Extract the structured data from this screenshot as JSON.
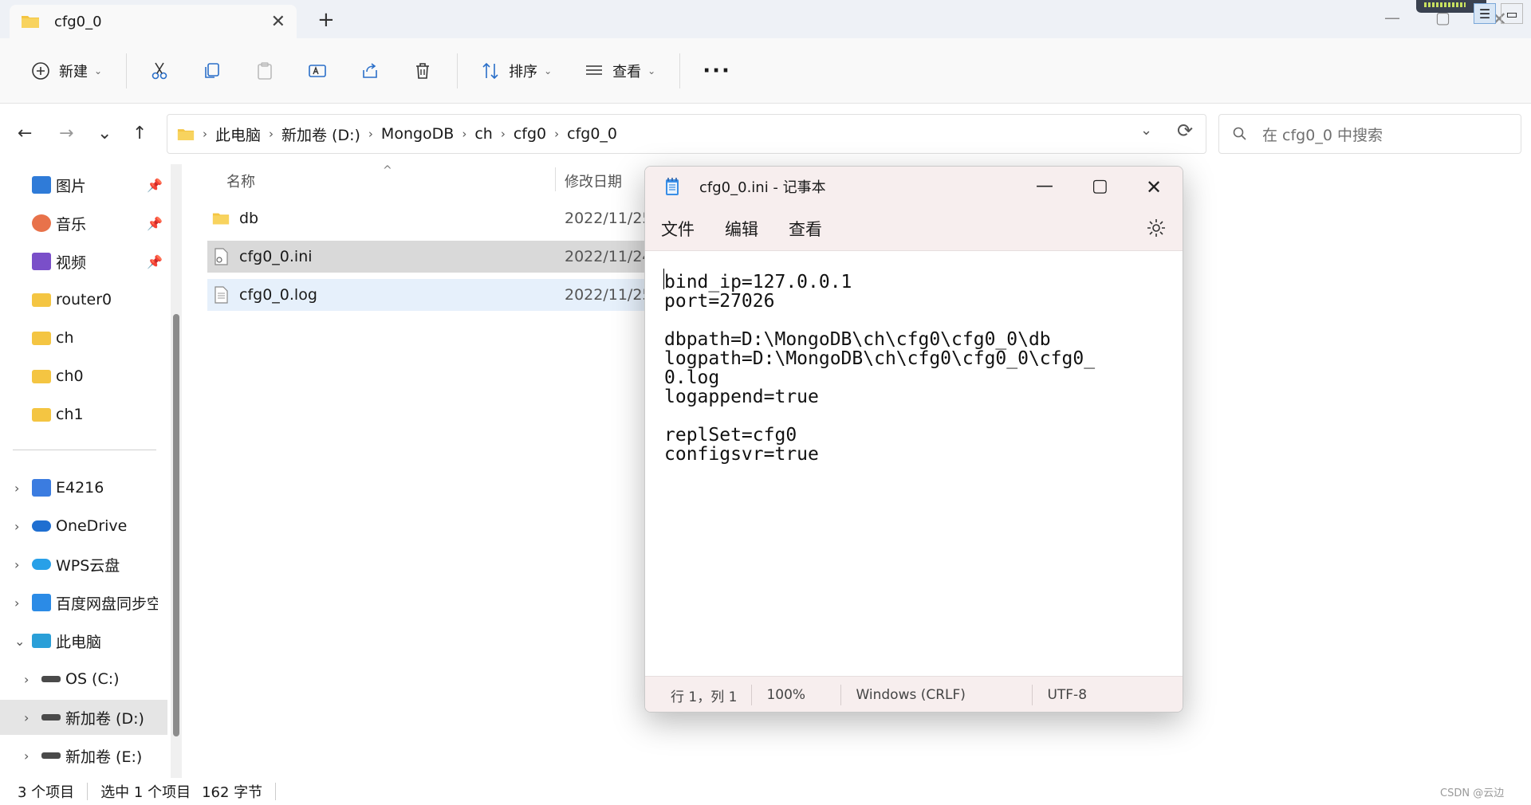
{
  "tab": {
    "title": "cfg0_0",
    "close": "✕",
    "new_tab": "+"
  },
  "window_controls": {
    "minimize": "—",
    "maximize": "▢",
    "close": "✕"
  },
  "toolbar": {
    "new_label": "新建",
    "sort_label": "排序",
    "view_label": "查看",
    "more_label": "···"
  },
  "nav": {
    "back": "←",
    "forward": "→",
    "recent": "⌄",
    "up": "↑"
  },
  "breadcrumb": [
    "此电脑",
    "新加卷 (D:)",
    "MongoDB",
    "ch",
    "cfg0",
    "cfg0_0"
  ],
  "address": {
    "dropdown": "⌄",
    "refresh": "⟳"
  },
  "search": {
    "placeholder": "在 cfg0_0 中搜索"
  },
  "sidebar": {
    "quick_access": [
      {
        "label": "图片",
        "icon": "pictures-icon",
        "color": "#2f7bd8"
      },
      {
        "label": "音乐",
        "icon": "music-icon",
        "color": "#e8724a"
      },
      {
        "label": "视频",
        "icon": "video-icon",
        "color": "#7a4fc9"
      },
      {
        "label": "router0",
        "icon": "folder-icon",
        "color": "#f4c542"
      },
      {
        "label": "ch",
        "icon": "folder-icon",
        "color": "#f4c542"
      },
      {
        "label": "ch0",
        "icon": "folder-icon",
        "color": "#f4c542"
      },
      {
        "label": "ch1",
        "icon": "folder-icon",
        "color": "#f4c542"
      }
    ],
    "tree": [
      {
        "label": "E4216",
        "icon": "user-folder-icon",
        "color": "#3b7ce0"
      },
      {
        "label": "OneDrive",
        "icon": "cloud-icon",
        "color": "#1f6fd1"
      },
      {
        "label": "WPS云盘",
        "icon": "cloud-icon",
        "color": "#28a0e8"
      },
      {
        "label": "百度网盘同步空",
        "icon": "sync-icon",
        "color": "#2b8be6"
      },
      {
        "label": "此电脑",
        "icon": "computer-icon",
        "color": "#2a9fd8"
      },
      {
        "label": "OS (C:)",
        "icon": "drive-icon",
        "color": "#4a4a4a"
      },
      {
        "label": "新加卷 (D:)",
        "icon": "drive-icon",
        "color": "#4a4a4a"
      },
      {
        "label": "新加卷 (E:)",
        "icon": "drive-icon",
        "color": "#4a4a4a"
      }
    ]
  },
  "filelist": {
    "columns": {
      "name": "名称",
      "date": "修改日期"
    },
    "rows": [
      {
        "name": "db",
        "date": "2022/11/25",
        "icon": "folder-icon"
      },
      {
        "name": "cfg0_0.ini",
        "date": "2022/11/24",
        "icon": "config-file-icon"
      },
      {
        "name": "cfg0_0.log",
        "date": "2022/11/25",
        "icon": "text-file-icon"
      }
    ]
  },
  "status": {
    "item_count": "3 个项目",
    "selection": "选中 1 个项目",
    "size": "162 字节"
  },
  "watermark": "CSDN @云边",
  "notepad": {
    "title": "cfg0_0.ini - 记事本",
    "menu": [
      "文件",
      "编辑",
      "查看"
    ],
    "content": "bind_ip=127.0.0.1\nport=27026\n\ndbpath=D:\\MongoDB\\ch\\cfg0\\cfg0_0\\db\nlogpath=D:\\MongoDB\\ch\\cfg0\\cfg0_0\\cfg0_\n0.log\nlogappend=true\n\nreplSet=cfg0\nconfigsvr=true",
    "status": {
      "position": "行 1，列 1",
      "zoom": "100%",
      "line_ending": "Windows (CRLF)",
      "encoding": "UTF-8"
    }
  }
}
